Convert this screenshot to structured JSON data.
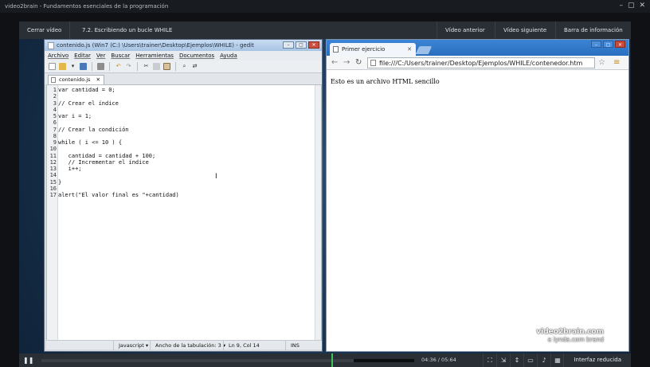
{
  "app": {
    "title": "video2brain - Fundamentos esenciales de la programación",
    "window_controls": [
      "–",
      "▢",
      "✕"
    ]
  },
  "player_top": {
    "close": "Cerrar vídeo",
    "chapter": "7.2. Escribiendo un bucle WHILE",
    "prev": "Vídeo anterior",
    "next": "Vídeo siguiente",
    "info": "Barra de información"
  },
  "gedit": {
    "title": "contenido.js (Win7 (C:) \\Users\\trainer\\Desktop\\Ejemplos\\WHILE) - gedit",
    "menu": [
      "Archivo",
      "Editar",
      "Ver",
      "Buscar",
      "Herramientas",
      "Documentos",
      "Ayuda"
    ],
    "tab": "contenido.js",
    "code": [
      {
        "n": "1",
        "t": "var cantidad = 0;"
      },
      {
        "n": "2",
        "t": ""
      },
      {
        "n": "3",
        "t": "// Crear el índice"
      },
      {
        "n": "4",
        "t": ""
      },
      {
        "n": "5",
        "t": "var i = 1;"
      },
      {
        "n": "6",
        "t": ""
      },
      {
        "n": "7",
        "t": "// Crear la condición"
      },
      {
        "n": "8",
        "t": ""
      },
      {
        "n": "9",
        "t": "while ( i <= 10 ) {"
      },
      {
        "n": "10",
        "t": ""
      },
      {
        "n": "11",
        "t": "   cantidad = cantidad + 100;"
      },
      {
        "n": "12",
        "t": "   // Incrementar el índice"
      },
      {
        "n": "13",
        "t": "   i++;"
      },
      {
        "n": "14",
        "t": ""
      },
      {
        "n": "15",
        "t": "}"
      },
      {
        "n": "16",
        "t": ""
      },
      {
        "n": "17",
        "t": "alert(\"El valor final es \"+cantidad)"
      }
    ],
    "status": {
      "language": "Javascript",
      "tab_width": "Ancho de la tabulación: 3",
      "position": "Ln 9, Col 14",
      "mode": "INS"
    }
  },
  "chrome": {
    "tab_title": "Primer ejercicio",
    "url": "file:///C:/Users/trainer/Desktop/Ejemplos/WHILE/contenedor.htm",
    "content": "Esto es un archivo HTML sencillo"
  },
  "watermark": {
    "line1": "video2brain.com",
    "line2": "a lynda.com brand"
  },
  "player_bottom": {
    "time": "04:36 / 05:64",
    "label": "Interfaz reducida",
    "progress": 0.838
  },
  "colors": {
    "accent_green": "#38c45a",
    "chrome_blue": "#2b6fbf"
  }
}
